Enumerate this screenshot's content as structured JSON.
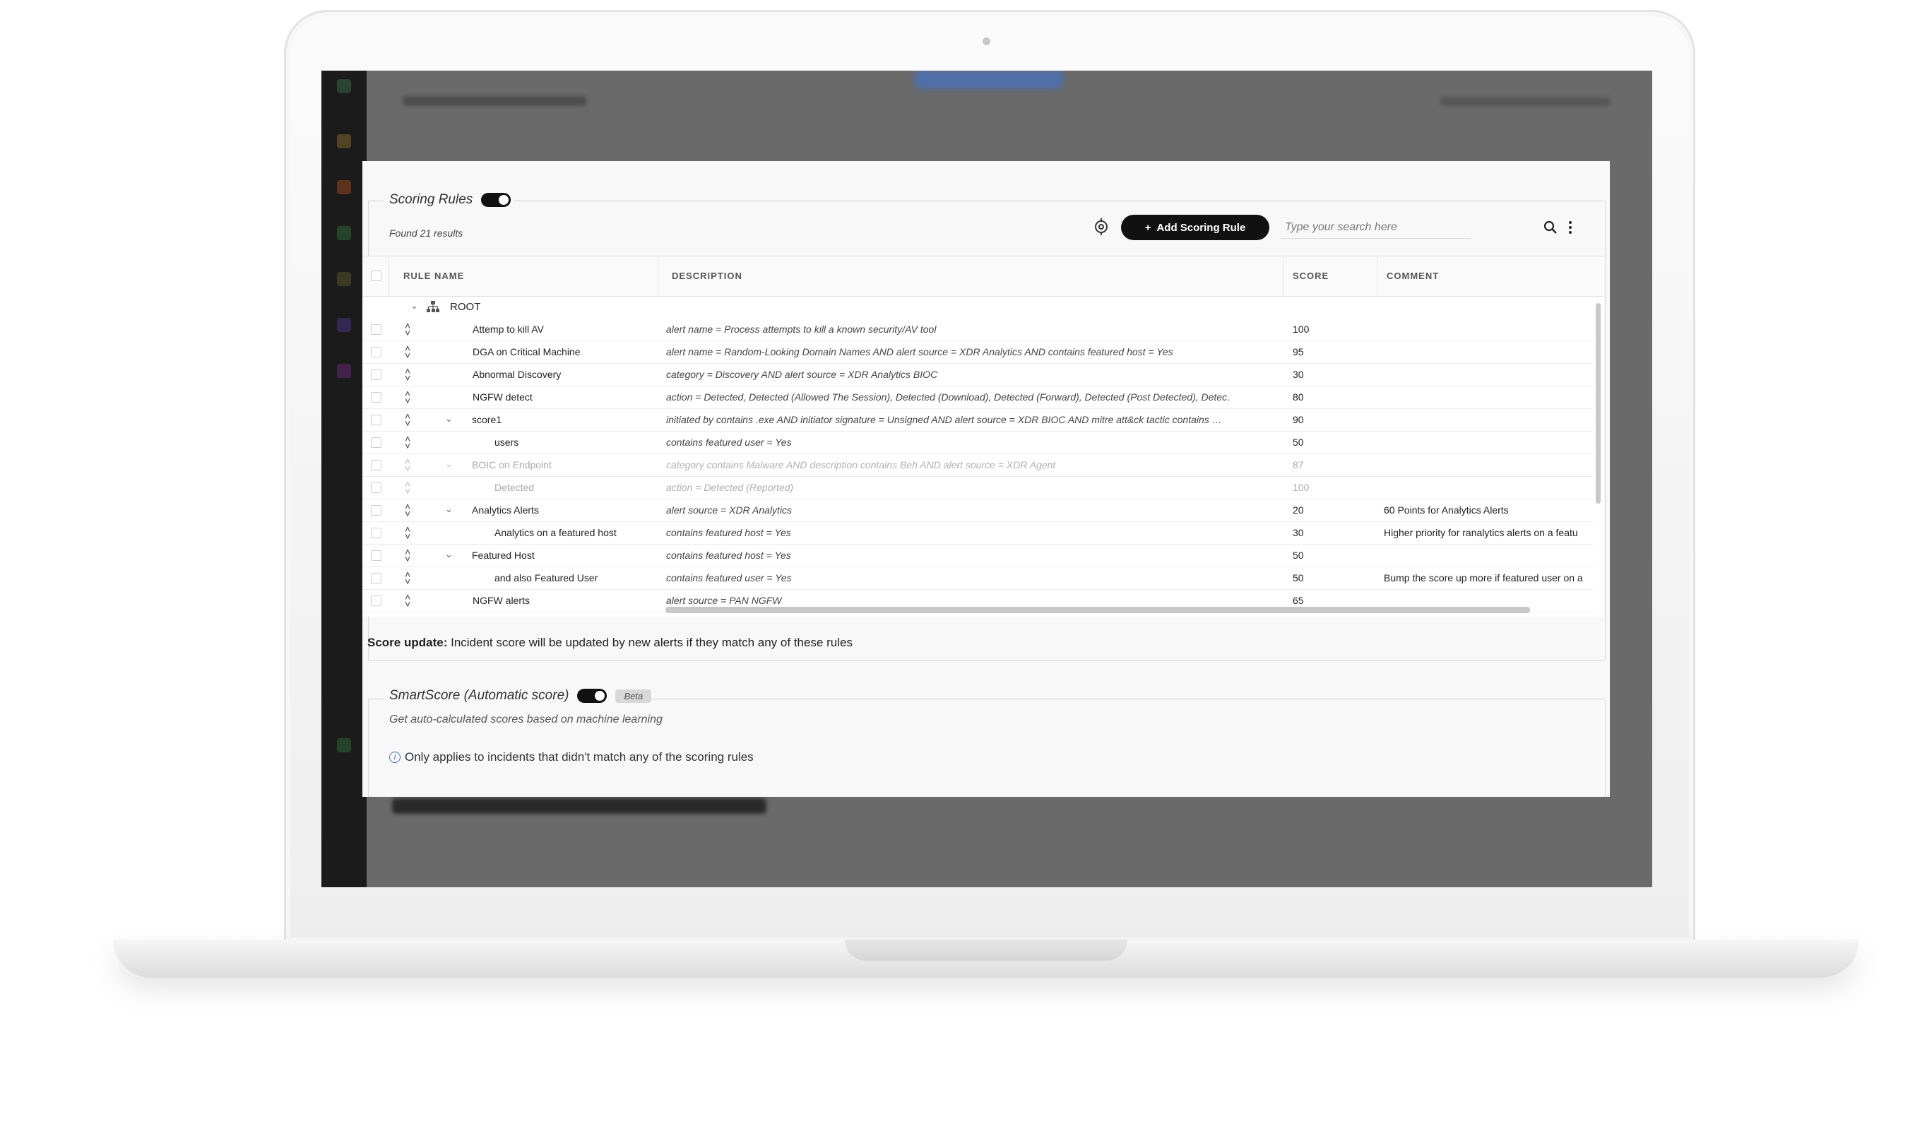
{
  "scoring_rules": {
    "title": "Scoring Rules",
    "found": "Found 21 results",
    "add_button": "Add Scoring Rule",
    "search_placeholder": "Type your search here",
    "columns": {
      "rule_name": "RULE NAME",
      "description": "DESCRIPTION",
      "score": "SCORE",
      "comment": "COMMENT"
    },
    "root_label": "ROOT",
    "rows": [
      {
        "name": "Attemp to kill AV",
        "desc": "alert name = Process attempts to kill a known security/AV tool",
        "score": "100",
        "comment": ""
      },
      {
        "name": "DGA on Critical Machine",
        "desc": "alert name = Random-Looking Domain Names AND alert source = XDR Analytics AND contains featured host = Yes",
        "score": "95",
        "comment": ""
      },
      {
        "name": "Abnormal Discovery",
        "desc": "category = Discovery AND alert source = XDR Analytics BIOC",
        "score": "30",
        "comment": ""
      },
      {
        "name": "NGFW detect",
        "desc": "action = Detected, Detected (Allowed The Session), Detected (Download), Detected (Forward), Detected (Post Detected), Detec…",
        "score": "80",
        "comment": ""
      },
      {
        "name": "score1",
        "desc": "initiated by contains .exe AND initiator signature = Unsigned AND alert source = XDR BIOC AND mitre att&ck tactic contains …",
        "score": "90",
        "comment": ""
      },
      {
        "name": "users",
        "desc": "contains featured user = Yes",
        "score": "50",
        "comment": ""
      },
      {
        "name": "BOIC on Endpoint",
        "desc": "category contains Malware AND description contains Beh AND alert source = XDR Agent",
        "score": "87",
        "comment": ""
      },
      {
        "name": "Detected",
        "desc": "action = Detected (Reported)",
        "score": "100",
        "comment": ""
      },
      {
        "name": "Analytics Alerts",
        "desc": "alert source = XDR Analytics",
        "score": "20",
        "comment": "60 Points for Analytics Alerts"
      },
      {
        "name": "Analytics on a featured host",
        "desc": "contains featured host = Yes",
        "score": "30",
        "comment": "Higher priority for ranalytics alerts on a featu"
      },
      {
        "name": "Featured Host",
        "desc": "contains featured host = Yes",
        "score": "50",
        "comment": ""
      },
      {
        "name": "and also Featured User",
        "desc": "contains featured user = Yes",
        "score": "50",
        "comment": "Bump the score up more if featured user on a"
      },
      {
        "name": "NGFW alerts",
        "desc": "alert source = PAN NGFW",
        "score": "65",
        "comment": ""
      }
    ]
  },
  "score_update": {
    "label": "Score update:",
    "text": "Incident score will be updated by new alerts if they match any of these rules"
  },
  "smart_score": {
    "title": "SmartScore (Automatic score)",
    "badge": "Beta",
    "subtitle": "Get auto-calculated scores based on machine learning",
    "note": "Only applies to incidents that didn't match any of the scoring rules"
  }
}
